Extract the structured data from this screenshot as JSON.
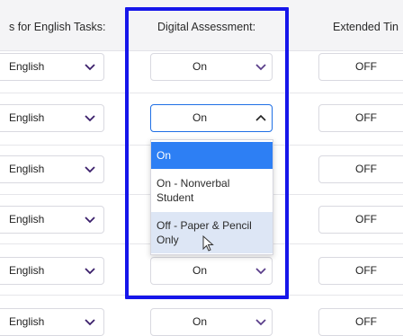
{
  "headers": {
    "accommodations": "s for English Tasks:",
    "digital_assessment": "Digital Assessment:",
    "extended_time": "Extended Tin"
  },
  "rows": [
    {
      "language": "English",
      "digital_assessment": "On",
      "extended_time": "OFF"
    },
    {
      "language": "English",
      "digital_assessment": "On",
      "extended_time": "OFF"
    },
    {
      "language": "English",
      "digital_assessment": "",
      "extended_time": "OFF"
    },
    {
      "language": "English",
      "digital_assessment": "",
      "extended_time": "OFF"
    },
    {
      "language": "English",
      "digital_assessment": "On",
      "extended_time": "OFF"
    },
    {
      "language": "English",
      "digital_assessment": "On",
      "extended_time": "OFF"
    }
  ],
  "dropdown": {
    "open_row_index": 1,
    "selected_value": "On",
    "hovered_option": "Off - Paper & Pencil Only",
    "options": [
      {
        "line1": "On",
        "line2": ""
      },
      {
        "line1": "On - Nonverbal",
        "line2": "Student"
      },
      {
        "line1": "Off - Paper & Pencil",
        "line2": "Only"
      }
    ]
  },
  "icons": {
    "chevron": "chevron-down-icon",
    "chevron_open": "chevron-up-icon",
    "cursor": "mouse-pointer-icon"
  },
  "colors": {
    "highlight_box": "#1616ea",
    "selected_option": "#2d7ff4",
    "hover_option": "#dde6f5",
    "chevron_lang": "#3b1f6b",
    "chevron_da": "#5a3e8a"
  }
}
